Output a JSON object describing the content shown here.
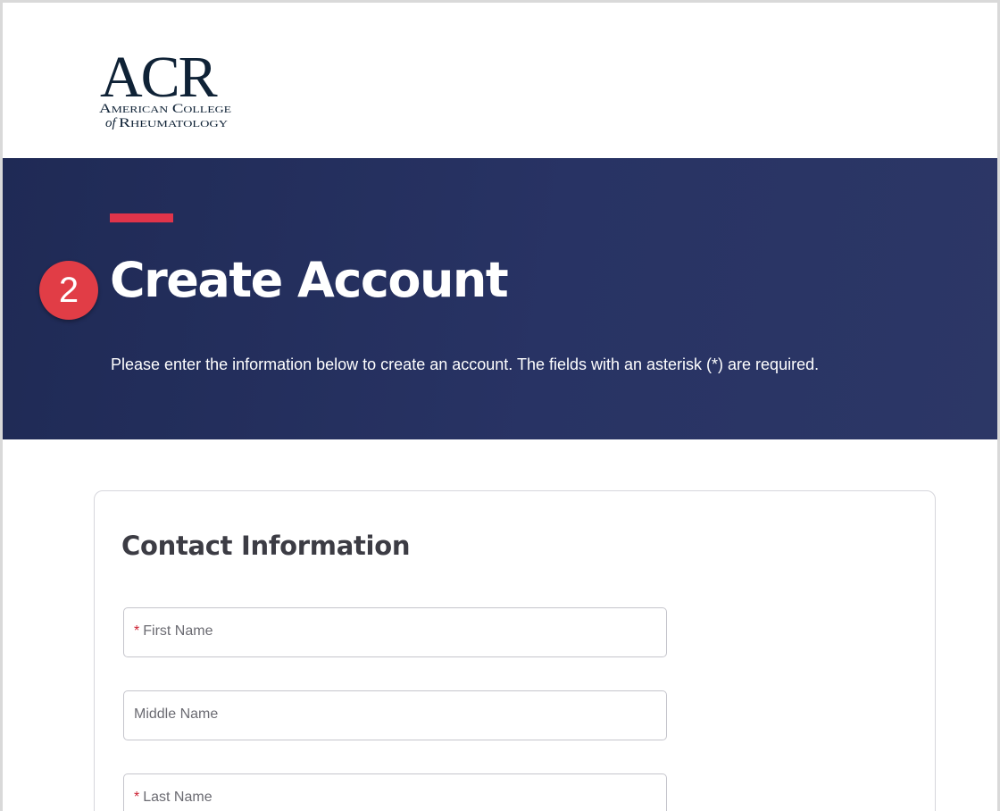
{
  "brand": {
    "logo_mark": "ACR",
    "logo_line1": "American College",
    "logo_line2_of": "of",
    "logo_line2": "Rheumatology"
  },
  "hero": {
    "step_number": "2",
    "title": "Create Account",
    "subtitle": "Please enter the information below to create an account. The fields with an asterisk (*) are required."
  },
  "form": {
    "section_title": "Contact Information",
    "required_marker": "*",
    "fields": [
      {
        "label": "First Name",
        "required": true,
        "value": ""
      },
      {
        "label": "Middle Name",
        "required": false,
        "value": ""
      },
      {
        "label": "Last Name",
        "required": true,
        "value": ""
      }
    ]
  },
  "colors": {
    "hero_background": "#26305f",
    "accent_red": "#e0344a",
    "badge_red": "#e13d46",
    "required_red": "#cc2233",
    "logo_navy": "#0f2236"
  }
}
